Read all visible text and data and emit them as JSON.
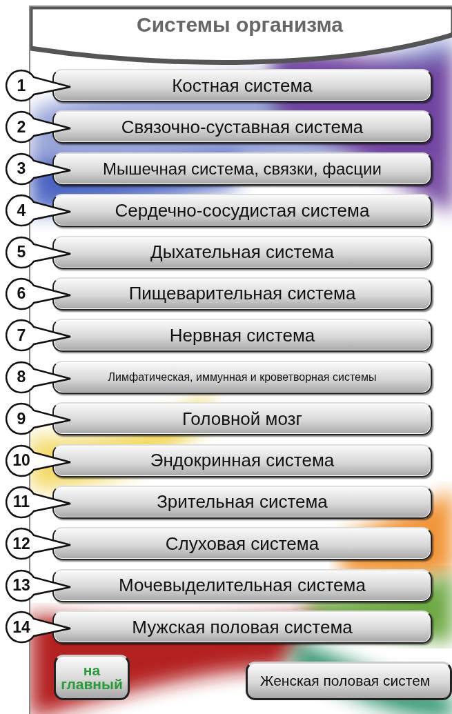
{
  "title": "Системы организма",
  "items": [
    {
      "number": "1",
      "label": "Костная система"
    },
    {
      "number": "2",
      "label": "Связочно-суставная система"
    },
    {
      "number": "3",
      "label": "Мышечная система, связки, фасции"
    },
    {
      "number": "4",
      "label": "Сердечно-сосудистая система"
    },
    {
      "number": "5",
      "label": "Дыхательная система"
    },
    {
      "number": "6",
      "label": "Пищеварительная система"
    },
    {
      "number": "7",
      "label": "Нервная система"
    },
    {
      "number": "8",
      "label": "Лимфатическая, иммунная и кроветворная системы"
    },
    {
      "number": "9",
      "label": "Головной мозг"
    },
    {
      "number": "10",
      "label": "Эндокринная система"
    },
    {
      "number": "11",
      "label": "Зрительная система"
    },
    {
      "number": "12",
      "label": "Слуховая система"
    },
    {
      "number": "13",
      "label": "Мочевыделительная система"
    },
    {
      "number": "14",
      "label": "Мужская половая система"
    }
  ],
  "home_button": "на главный",
  "extra_button": "Женская половая систем"
}
